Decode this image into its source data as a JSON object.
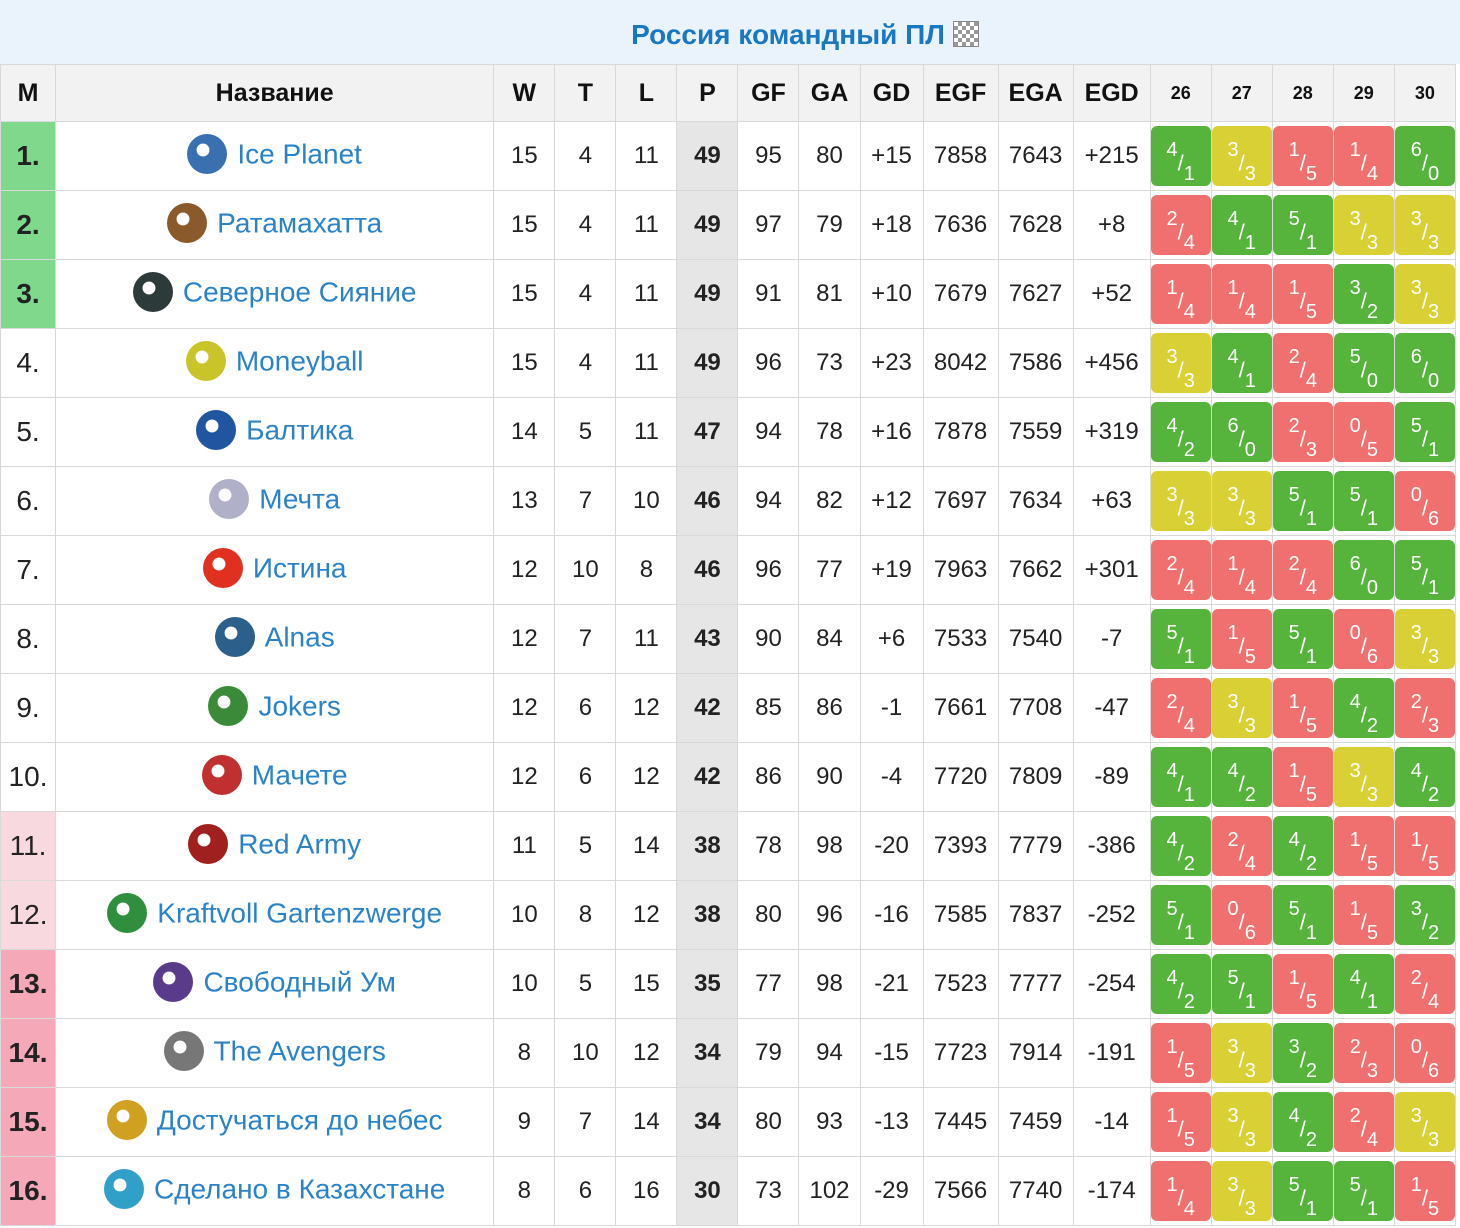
{
  "title": "Россия командный ПЛ",
  "headers": [
    "M",
    "Название",
    "W",
    "T",
    "L",
    "P",
    "GF",
    "GA",
    "GD",
    "EGF",
    "EGA",
    "EGD"
  ],
  "matchdays": [
    "26",
    "27",
    "28",
    "29",
    "30"
  ],
  "colors": {
    "win": "#56b33c",
    "draw": "#d8d034",
    "loss": "#f06f6f",
    "link": "#2a82c8",
    "green_zone": "#7fd88c",
    "pink_light": "#f8d9e0",
    "pink_dark": "#f5a9b8"
  },
  "rows": [
    {
      "pos": "1.",
      "zone": "green",
      "name": "Ice Planet",
      "logo": "ice-planet-logo",
      "W": "15",
      "T": "4",
      "L": "11",
      "P": "49",
      "GF": "95",
      "GA": "80",
      "GD": "+15",
      "EGF": "7858",
      "EGA": "7643",
      "EGD": "+215",
      "results": [
        {
          "a": "4",
          "b": "1",
          "o": "win"
        },
        {
          "a": "3",
          "b": "3",
          "o": "draw"
        },
        {
          "a": "1",
          "b": "5",
          "o": "loss"
        },
        {
          "a": "1",
          "b": "4",
          "o": "loss"
        },
        {
          "a": "6",
          "b": "0",
          "o": "win"
        }
      ]
    },
    {
      "pos": "2.",
      "zone": "green",
      "name": "Ратамахатта",
      "logo": "ratamahatta-logo",
      "W": "15",
      "T": "4",
      "L": "11",
      "P": "49",
      "GF": "97",
      "GA": "79",
      "GD": "+18",
      "EGF": "7636",
      "EGA": "7628",
      "EGD": "+8",
      "results": [
        {
          "a": "2",
          "b": "4",
          "o": "loss"
        },
        {
          "a": "4",
          "b": "1",
          "o": "win"
        },
        {
          "a": "5",
          "b": "1",
          "o": "win"
        },
        {
          "a": "3",
          "b": "3",
          "o": "draw"
        },
        {
          "a": "3",
          "b": "3",
          "o": "draw"
        }
      ]
    },
    {
      "pos": "3.",
      "zone": "green",
      "name": "Северное Сияние",
      "logo": "severnoe-siyanie-logo",
      "W": "15",
      "T": "4",
      "L": "11",
      "P": "49",
      "GF": "91",
      "GA": "81",
      "GD": "+10",
      "EGF": "7679",
      "EGA": "7627",
      "EGD": "+52",
      "results": [
        {
          "a": "1",
          "b": "4",
          "o": "loss"
        },
        {
          "a": "1",
          "b": "4",
          "o": "loss"
        },
        {
          "a": "1",
          "b": "5",
          "o": "loss"
        },
        {
          "a": "3",
          "b": "2",
          "o": "win"
        },
        {
          "a": "3",
          "b": "3",
          "o": "draw"
        }
      ]
    },
    {
      "pos": "4.",
      "zone": "",
      "name": "Moneyball",
      "logo": "moneyball-logo",
      "W": "15",
      "T": "4",
      "L": "11",
      "P": "49",
      "GF": "96",
      "GA": "73",
      "GD": "+23",
      "EGF": "8042",
      "EGA": "7586",
      "EGD": "+456",
      "results": [
        {
          "a": "3",
          "b": "3",
          "o": "draw"
        },
        {
          "a": "4",
          "b": "1",
          "o": "win"
        },
        {
          "a": "2",
          "b": "4",
          "o": "loss"
        },
        {
          "a": "5",
          "b": "0",
          "o": "win"
        },
        {
          "a": "6",
          "b": "0",
          "o": "win"
        }
      ]
    },
    {
      "pos": "5.",
      "zone": "",
      "name": "Балтика",
      "logo": "baltika-logo",
      "W": "14",
      "T": "5",
      "L": "11",
      "P": "47",
      "GF": "94",
      "GA": "78",
      "GD": "+16",
      "EGF": "7878",
      "EGA": "7559",
      "EGD": "+319",
      "results": [
        {
          "a": "4",
          "b": "2",
          "o": "win"
        },
        {
          "a": "6",
          "b": "0",
          "o": "win"
        },
        {
          "a": "2",
          "b": "3",
          "o": "loss"
        },
        {
          "a": "0",
          "b": "5",
          "o": "loss"
        },
        {
          "a": "5",
          "b": "1",
          "o": "win"
        }
      ]
    },
    {
      "pos": "6.",
      "zone": "",
      "name": "Мечта",
      "logo": "mechta-logo",
      "W": "13",
      "T": "7",
      "L": "10",
      "P": "46",
      "GF": "94",
      "GA": "82",
      "GD": "+12",
      "EGF": "7697",
      "EGA": "7634",
      "EGD": "+63",
      "results": [
        {
          "a": "3",
          "b": "3",
          "o": "draw"
        },
        {
          "a": "3",
          "b": "3",
          "o": "draw"
        },
        {
          "a": "5",
          "b": "1",
          "o": "win"
        },
        {
          "a": "5",
          "b": "1",
          "o": "win"
        },
        {
          "a": "0",
          "b": "6",
          "o": "loss"
        }
      ]
    },
    {
      "pos": "7.",
      "zone": "",
      "name": "Истина",
      "logo": "istina-logo",
      "W": "12",
      "T": "10",
      "L": "8",
      "P": "46",
      "GF": "96",
      "GA": "77",
      "GD": "+19",
      "EGF": "7963",
      "EGA": "7662",
      "EGD": "+301",
      "results": [
        {
          "a": "2",
          "b": "4",
          "o": "loss"
        },
        {
          "a": "1",
          "b": "4",
          "o": "loss"
        },
        {
          "a": "2",
          "b": "4",
          "o": "loss"
        },
        {
          "a": "6",
          "b": "0",
          "o": "win"
        },
        {
          "a": "5",
          "b": "1",
          "o": "win"
        }
      ]
    },
    {
      "pos": "8.",
      "zone": "",
      "name": "Alnas",
      "logo": "alnas-logo",
      "W": "12",
      "T": "7",
      "L": "11",
      "P": "43",
      "GF": "90",
      "GA": "84",
      "GD": "+6",
      "EGF": "7533",
      "EGA": "7540",
      "EGD": "-7",
      "results": [
        {
          "a": "5",
          "b": "1",
          "o": "win"
        },
        {
          "a": "1",
          "b": "5",
          "o": "loss"
        },
        {
          "a": "5",
          "b": "1",
          "o": "win"
        },
        {
          "a": "0",
          "b": "6",
          "o": "loss"
        },
        {
          "a": "3",
          "b": "3",
          "o": "draw"
        }
      ]
    },
    {
      "pos": "9.",
      "zone": "",
      "name": "Jokers",
      "logo": "jokers-logo",
      "W": "12",
      "T": "6",
      "L": "12",
      "P": "42",
      "GF": "85",
      "GA": "86",
      "GD": "-1",
      "EGF": "7661",
      "EGA": "7708",
      "EGD": "-47",
      "results": [
        {
          "a": "2",
          "b": "4",
          "o": "loss"
        },
        {
          "a": "3",
          "b": "3",
          "o": "draw"
        },
        {
          "a": "1",
          "b": "5",
          "o": "loss"
        },
        {
          "a": "4",
          "b": "2",
          "o": "win"
        },
        {
          "a": "2",
          "b": "3",
          "o": "loss"
        }
      ]
    },
    {
      "pos": "10.",
      "zone": "",
      "name": "Мачете",
      "logo": "machete-logo",
      "W": "12",
      "T": "6",
      "L": "12",
      "P": "42",
      "GF": "86",
      "GA": "90",
      "GD": "-4",
      "EGF": "7720",
      "EGA": "7809",
      "EGD": "-89",
      "results": [
        {
          "a": "4",
          "b": "1",
          "o": "win"
        },
        {
          "a": "4",
          "b": "2",
          "o": "win"
        },
        {
          "a": "1",
          "b": "5",
          "o": "loss"
        },
        {
          "a": "3",
          "b": "3",
          "o": "draw"
        },
        {
          "a": "4",
          "b": "2",
          "o": "win"
        }
      ]
    },
    {
      "pos": "11.",
      "zone": "pink1",
      "name": "Red Army",
      "logo": "red-army-logo",
      "W": "11",
      "T": "5",
      "L": "14",
      "P": "38",
      "GF": "78",
      "GA": "98",
      "GD": "-20",
      "EGF": "7393",
      "EGA": "7779",
      "EGD": "-386",
      "results": [
        {
          "a": "4",
          "b": "2",
          "o": "win"
        },
        {
          "a": "2",
          "b": "4",
          "o": "loss"
        },
        {
          "a": "4",
          "b": "2",
          "o": "win"
        },
        {
          "a": "1",
          "b": "5",
          "o": "loss"
        },
        {
          "a": "1",
          "b": "5",
          "o": "loss"
        }
      ]
    },
    {
      "pos": "12.",
      "zone": "pink1",
      "name": "Kraftvoll Gartenzwerge",
      "logo": "kraftvoll-logo",
      "W": "10",
      "T": "8",
      "L": "12",
      "P": "38",
      "GF": "80",
      "GA": "96",
      "GD": "-16",
      "EGF": "7585",
      "EGA": "7837",
      "EGD": "-252",
      "results": [
        {
          "a": "5",
          "b": "1",
          "o": "win"
        },
        {
          "a": "0",
          "b": "6",
          "o": "loss"
        },
        {
          "a": "5",
          "b": "1",
          "o": "win"
        },
        {
          "a": "1",
          "b": "5",
          "o": "loss"
        },
        {
          "a": "3",
          "b": "2",
          "o": "win"
        }
      ]
    },
    {
      "pos": "13.",
      "zone": "pink2",
      "name": "Свободный Ум",
      "logo": "svobodny-um-logo",
      "W": "10",
      "T": "5",
      "L": "15",
      "P": "35",
      "GF": "77",
      "GA": "98",
      "GD": "-21",
      "EGF": "7523",
      "EGA": "7777",
      "EGD": "-254",
      "results": [
        {
          "a": "4",
          "b": "2",
          "o": "win"
        },
        {
          "a": "5",
          "b": "1",
          "o": "win"
        },
        {
          "a": "1",
          "b": "5",
          "o": "loss"
        },
        {
          "a": "4",
          "b": "1",
          "o": "win"
        },
        {
          "a": "2",
          "b": "4",
          "o": "loss"
        }
      ]
    },
    {
      "pos": "14.",
      "zone": "pink2",
      "name": "The Avengers",
      "logo": "avengers-logo",
      "W": "8",
      "T": "10",
      "L": "12",
      "P": "34",
      "GF": "79",
      "GA": "94",
      "GD": "-15",
      "EGF": "7723",
      "EGA": "7914",
      "EGD": "-191",
      "results": [
        {
          "a": "1",
          "b": "5",
          "o": "loss"
        },
        {
          "a": "3",
          "b": "3",
          "o": "draw"
        },
        {
          "a": "3",
          "b": "2",
          "o": "win"
        },
        {
          "a": "2",
          "b": "3",
          "o": "loss"
        },
        {
          "a": "0",
          "b": "6",
          "o": "loss"
        }
      ]
    },
    {
      "pos": "15.",
      "zone": "pink2",
      "name": "Достучаться до небес",
      "logo": "dostuchatsya-logo",
      "W": "9",
      "T": "7",
      "L": "14",
      "P": "34",
      "GF": "80",
      "GA": "93",
      "GD": "-13",
      "EGF": "7445",
      "EGA": "7459",
      "EGD": "-14",
      "results": [
        {
          "a": "1",
          "b": "5",
          "o": "loss"
        },
        {
          "a": "3",
          "b": "3",
          "o": "draw"
        },
        {
          "a": "4",
          "b": "2",
          "o": "win"
        },
        {
          "a": "2",
          "b": "4",
          "o": "loss"
        },
        {
          "a": "3",
          "b": "3",
          "o": "draw"
        }
      ]
    },
    {
      "pos": "16.",
      "zone": "pink2",
      "name": "Сделано в Казахстане",
      "logo": "kazakhstan-logo",
      "W": "8",
      "T": "6",
      "L": "16",
      "P": "30",
      "GF": "73",
      "GA": "102",
      "GD": "-29",
      "EGF": "7566",
      "EGA": "7740",
      "EGD": "-174",
      "results": [
        {
          "a": "1",
          "b": "4",
          "o": "loss"
        },
        {
          "a": "3",
          "b": "3",
          "o": "draw"
        },
        {
          "a": "5",
          "b": "1",
          "o": "win"
        },
        {
          "a": "5",
          "b": "1",
          "o": "win"
        },
        {
          "a": "1",
          "b": "5",
          "o": "loss"
        }
      ]
    }
  ]
}
